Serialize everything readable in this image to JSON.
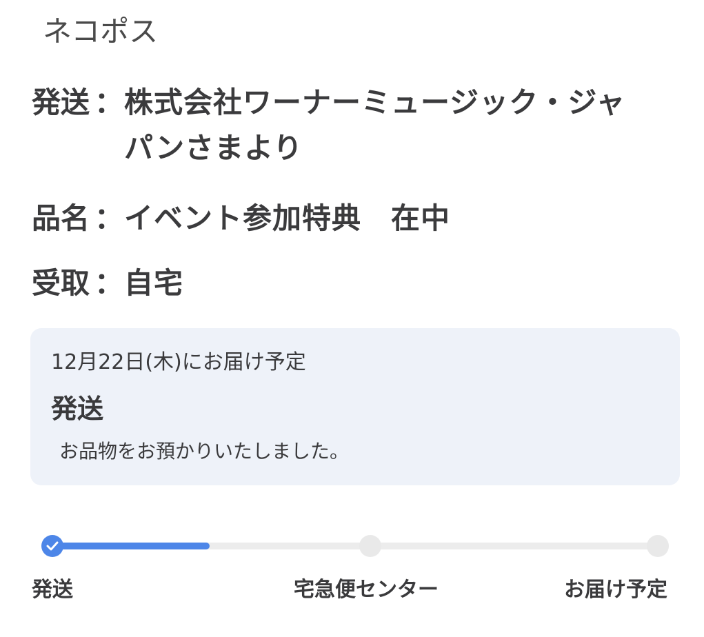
{
  "service": {
    "name": "ネコポス"
  },
  "details": {
    "colon": "：",
    "sender_label": "発送",
    "sender_value": "株式会社ワーナーミュージック・ジャパンさまより",
    "item_label": "品名",
    "item_value": "イベント参加特典　在中",
    "receive_label": "受取",
    "receive_value": "自宅"
  },
  "status_card": {
    "delivery_date": "12月22日(木)にお届け予定",
    "status_title": "発送",
    "status_message": "お品物をお預かりいたしました。"
  },
  "progress": {
    "completed_fraction": 0.26,
    "steps": [
      {
        "label": "発送",
        "state": "done",
        "icon": "check-icon"
      },
      {
        "label": "宅急便センター",
        "state": "pending"
      },
      {
        "label": "お届け予定",
        "state": "pending"
      }
    ]
  },
  "colors": {
    "accent": "#4d86e8",
    "card_background": "#eef2f9",
    "track": "#ececec"
  }
}
